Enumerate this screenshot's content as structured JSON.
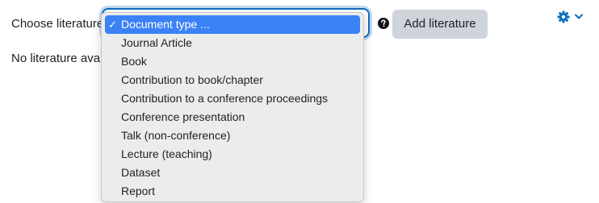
{
  "form": {
    "choose_label": "Choose literature",
    "no_literature_text": "No literature available",
    "add_button_label": "Add literature"
  },
  "dropdown": {
    "selected": "Document type ...",
    "options": [
      "Document type ...",
      "Journal Article",
      "Book",
      "Contribution to book/chapter",
      "Contribution to a conference proceedings",
      "Conference presentation",
      "Talk (non-conference)",
      "Lecture (teaching)",
      "Dataset",
      "Report"
    ]
  },
  "icons": {
    "help": "question-circle-icon",
    "settings": "gear-icon",
    "menu_caret": "chevron-down-icon",
    "selected_marker": "checkmark-icon"
  },
  "colors": {
    "accent": "#0f6cbf",
    "selected_option_bg": "#3b82f6",
    "button_bg": "#ced4da",
    "dropdown_bg": "#ececec"
  }
}
